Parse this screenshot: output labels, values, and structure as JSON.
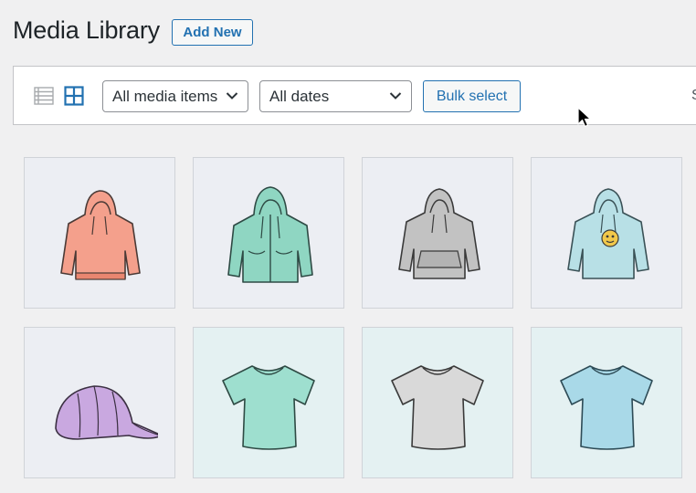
{
  "header": {
    "title": "Media Library",
    "add_new_label": "Add New"
  },
  "toolbar": {
    "type_filter": {
      "selected": "All media items"
    },
    "date_filter": {
      "selected": "All dates"
    },
    "bulk_select_label": "Bulk select",
    "search_partial": "S"
  },
  "icons": {
    "list_view": "list-view-icon",
    "grid_view": "grid-view-icon",
    "dropdown": "chevron-down-icon",
    "cursor": "mouse-pointer-icon"
  },
  "colors": {
    "accent": "#2271b1",
    "hoodie_orange": "#f4a08c",
    "hoodie_green": "#8fd6c2",
    "hoodie_gray": "#c2c2c2",
    "hoodie_blue": "#b8e0e6",
    "cap_purple": "#c9a8e0",
    "tee_green": "#9edfcf",
    "tee_gray": "#d9d9d9",
    "tee_blue": "#a9d9e8"
  },
  "media": [
    {
      "item": "hoodie",
      "color": "#f4a08c"
    },
    {
      "item": "zip-hoodie",
      "color": "#8fd6c2"
    },
    {
      "item": "pocket-hoodie",
      "color": "#c2c2c2"
    },
    {
      "item": "hoodie-with-logo",
      "color": "#b8e0e6"
    },
    {
      "item": "cap",
      "color": "#c9a8e0"
    },
    {
      "item": "t-shirt",
      "color": "#9edfcf"
    },
    {
      "item": "t-shirt",
      "color": "#d9d9d9"
    },
    {
      "item": "t-shirt",
      "color": "#a9d9e8"
    }
  ]
}
